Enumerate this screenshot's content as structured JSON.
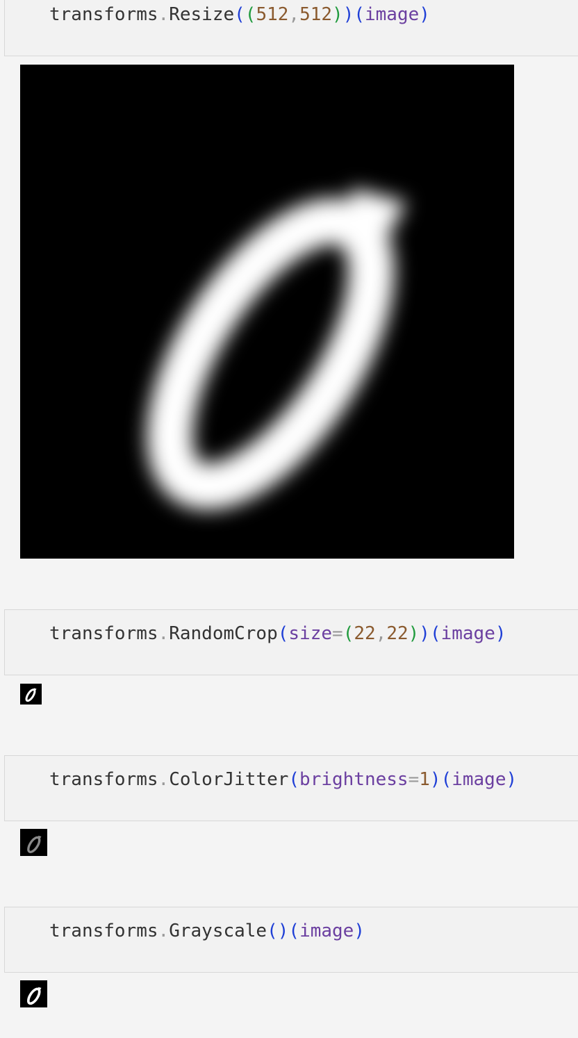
{
  "cells": [
    {
      "tokens": {
        "obj": "transforms",
        "dot": ".",
        "fn": "Resize",
        "p1": "(",
        "p2": "(",
        "n1": "512",
        "comma": ",",
        "n2": "512",
        "p3": ")",
        "p4": ")",
        "p5": "(",
        "arg": "image",
        "p6": ")"
      }
    },
    {
      "tokens": {
        "obj": "transforms",
        "dot": ".",
        "fn": "RandomCrop",
        "p1": "(",
        "kw": "size",
        "eq": "=",
        "p2": "(",
        "n1": "22",
        "comma": ",",
        "n2": "22",
        "p3": ")",
        "p4": ")",
        "p5": "(",
        "arg": "image",
        "p6": ")"
      }
    },
    {
      "tokens": {
        "obj": "transforms",
        "dot": ".",
        "fn": "ColorJitter",
        "p1": "(",
        "kw": "brightness",
        "eq": "=",
        "n1": "1",
        "p4": ")",
        "p5": "(",
        "arg": "image",
        "p6": ")"
      }
    },
    {
      "tokens": {
        "obj": "transforms",
        "dot": ".",
        "fn": "Grayscale",
        "p1": "(",
        "p4": ")",
        "p5": "(",
        "arg": "image",
        "p6": ")"
      }
    }
  ],
  "outputs": [
    {
      "name": "resized-digit-image",
      "content": "digit zero, white on black",
      "stroke": "#ffffff"
    },
    {
      "name": "randomcrop-digit-image",
      "content": "digit zero, white on black",
      "stroke": "#ffffff"
    },
    {
      "name": "colorjitter-digit-image",
      "content": "digit zero, dimmed",
      "stroke": "#8a8a8a"
    },
    {
      "name": "grayscale-digit-image",
      "content": "digit zero, white on black",
      "stroke": "#ffffff"
    }
  ],
  "colors": {
    "background": "#f4f4f4",
    "cell_background": "#f2f2f2",
    "cell_border": "#d7d7d7",
    "function_paren": "#1f3fd6",
    "inner_paren": "#1f9a3c",
    "number": "#8a5a2e",
    "keyword": "#6b3fa0",
    "operator": "#9a9a9a"
  }
}
